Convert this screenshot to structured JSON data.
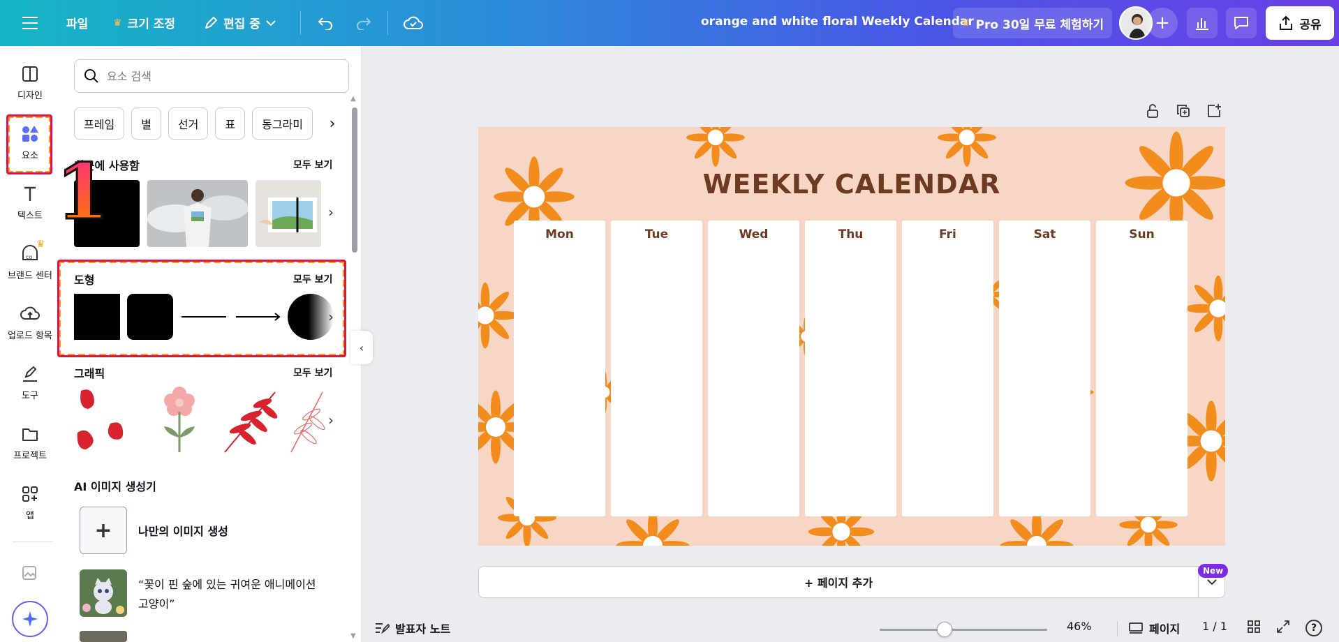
{
  "topbar": {
    "file_label": "파일",
    "resize_label": "크기 조정",
    "edit_label": "편집 중",
    "doc_title": "orange and white floral Weekly Calendar",
    "pro_label": "Pro 30일 무료 체험하기",
    "share_label": "공유"
  },
  "rail": {
    "items": [
      {
        "label": "디자인",
        "icon": "design-icon"
      },
      {
        "label": "요소",
        "icon": "elements-icon"
      },
      {
        "label": "텍스트",
        "icon": "text-icon"
      },
      {
        "label": "브랜드 센터",
        "icon": "brand-icon"
      },
      {
        "label": "업로드 항목",
        "icon": "upload-icon"
      },
      {
        "label": "도구",
        "icon": "draw-icon"
      },
      {
        "label": "프로젝트",
        "icon": "folder-icon"
      },
      {
        "label": "앱",
        "icon": "apps-icon"
      }
    ]
  },
  "panel": {
    "search_placeholder": "요소 검색",
    "chips": [
      "프레임",
      "별",
      "선거",
      "표",
      "동그라미"
    ],
    "recent_title": "최근에 사용함",
    "see_all": "모두 보기",
    "shapes_title": "도형",
    "graphics_title": "그래픽",
    "ai_title": "AI 이미지 생성기",
    "ai_create_label": "나만의 이미지 생성",
    "ai_prompt_line1": "“꽃이 핀 숲에 있는 귀여운 애니메이션",
    "ai_prompt_line2": "고양이”"
  },
  "annotation": {
    "marker": "1"
  },
  "canvas": {
    "title": "WEEKLY CALENDAR",
    "days": [
      "Mon",
      "Tue",
      "Wed",
      "Thu",
      "Fri",
      "Sat",
      "Sun"
    ],
    "add_page_label": "+ 페이지 추가",
    "new_badge": "New"
  },
  "bottombar": {
    "notes_label": "발표자 노트",
    "zoom_value": "46%",
    "zoom_level": 0.46,
    "pages_label": "페이지",
    "page_count": "1 / 1",
    "help_label": "?"
  },
  "colors": {
    "page_bg": "#f7d6c6",
    "petal": "#f28c1c",
    "title": "#6e3a22",
    "accent_purple": "#7d2ae8"
  }
}
